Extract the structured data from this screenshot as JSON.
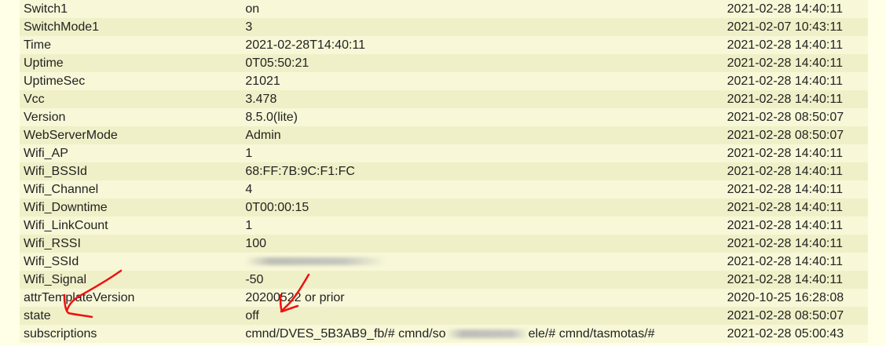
{
  "readings": {
    "rows": [
      {
        "name": "Switch1",
        "value": "on",
        "time": "2021-02-28 14:40:11"
      },
      {
        "name": "SwitchMode1",
        "value": "3",
        "time": "2021-02-07 10:43:11"
      },
      {
        "name": "Time",
        "value": "2021-02-28T14:40:11",
        "time": "2021-02-28 14:40:11"
      },
      {
        "name": "Uptime",
        "value": "0T05:50:21",
        "time": "2021-02-28 14:40:11"
      },
      {
        "name": "UptimeSec",
        "value": "21021",
        "time": "2021-02-28 14:40:11"
      },
      {
        "name": "Vcc",
        "value": "3.478",
        "time": "2021-02-28 14:40:11"
      },
      {
        "name": "Version",
        "value": "8.5.0(lite)",
        "time": "2021-02-28 08:50:07"
      },
      {
        "name": "WebServerMode",
        "value": "Admin",
        "time": "2021-02-28 08:50:07"
      },
      {
        "name": "Wifi_AP",
        "value": "1",
        "time": "2021-02-28 14:40:11"
      },
      {
        "name": "Wifi_BSSId",
        "value": "68:FF:7B:9C:F1:FC",
        "time": "2021-02-28 14:40:11"
      },
      {
        "name": "Wifi_Channel",
        "value": "4",
        "time": "2021-02-28 14:40:11"
      },
      {
        "name": "Wifi_Downtime",
        "value": "0T00:00:15",
        "time": "2021-02-28 14:40:11"
      },
      {
        "name": "Wifi_LinkCount",
        "value": "1",
        "time": "2021-02-28 14:40:11"
      },
      {
        "name": "Wifi_RSSI",
        "value": "100",
        "time": "2021-02-28 14:40:11"
      },
      {
        "name": "Wifi_SSId",
        "value": "",
        "time": "2021-02-28 14:40:11"
      },
      {
        "name": "Wifi_Signal",
        "value": "-50",
        "time": "2021-02-28 14:40:11"
      },
      {
        "name": "attrTemplateVersion",
        "value": "20200522 or prior",
        "time": "2020-10-25 16:28:08"
      },
      {
        "name": "state",
        "value": "off",
        "time": "2021-02-28 08:50:07"
      },
      {
        "name": "subscriptions",
        "value": "",
        "time": "2021-02-28 05:00:43"
      }
    ],
    "subscriptions_parts": {
      "a": "cmnd/DVES_5B3AB9_fb/# cmnd/so",
      "b": "ele/# cmnd/tasmotas/#"
    }
  },
  "annotations": {
    "arrow_color": "#EE1111",
    "redacted": [
      "Wifi_SSId value",
      "subscriptions middle segment"
    ]
  }
}
